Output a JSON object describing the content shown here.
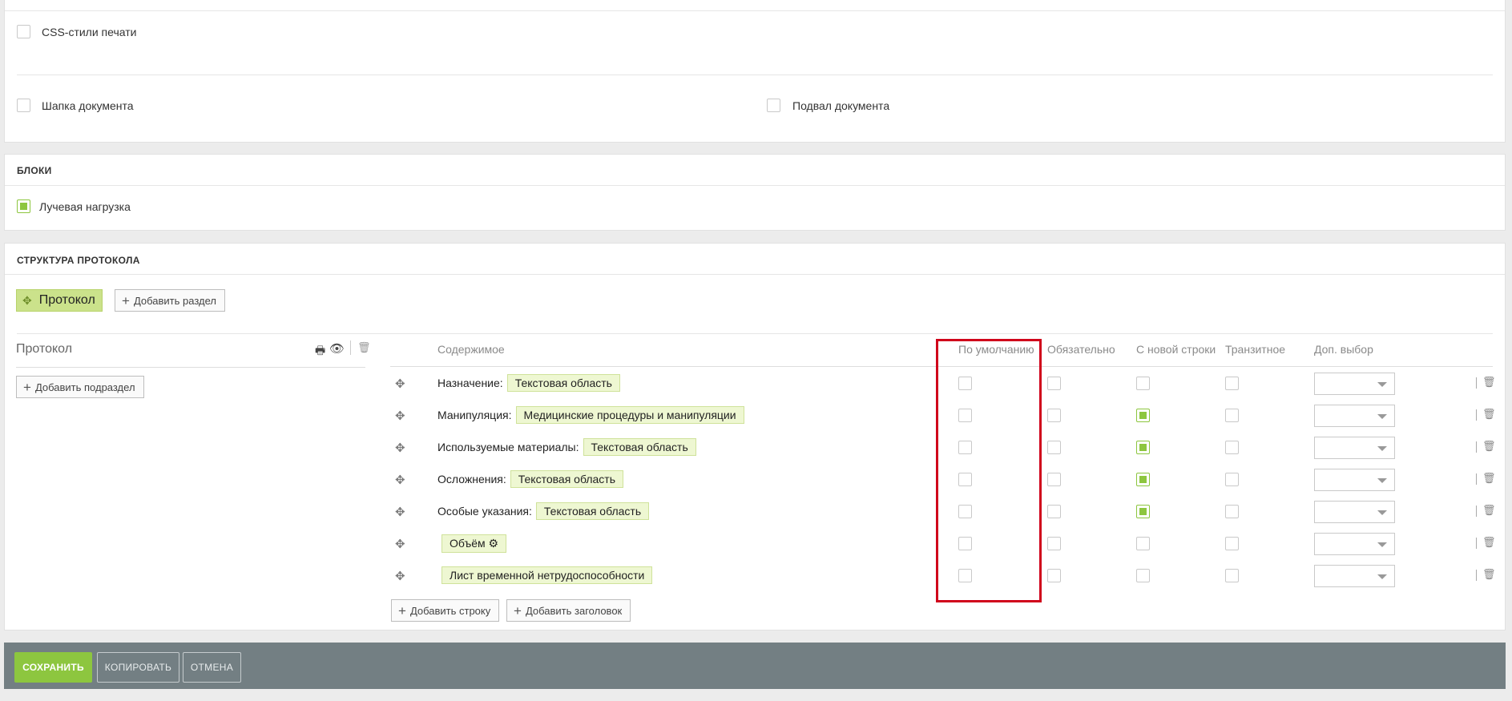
{
  "print_settings": {
    "css_print_label": "CSS-стили печати",
    "header_label": "Шапка документа",
    "footer_label": "Подвал документа"
  },
  "blocks": {
    "title": "БЛОКИ",
    "item_label": "Лучевая нагрузка"
  },
  "structure": {
    "title": "СТРУКТУРА ПРОТОКОЛА",
    "protocol_tab": "Протокол",
    "add_section": "Добавить раздел",
    "section_name": "Протокол",
    "add_subsection": "Добавить подраздел",
    "columns": {
      "content": "Содержимое",
      "default": "По умолчанию",
      "required": "Обязательно",
      "new_line": "С новой строки",
      "transit": "Транзитное",
      "extra_choice": "Доп. выбор"
    },
    "rows": [
      {
        "label": "Назначение:",
        "tag": "Текстовая область",
        "default": false,
        "required": false,
        "new_line": false,
        "transit": false
      },
      {
        "label": "Манипуляция:",
        "tag": "Медицинские процедуры и манипуляции",
        "default": false,
        "required": false,
        "new_line": true,
        "transit": false
      },
      {
        "label": "Используемые материалы:",
        "tag": "Текстовая область",
        "default": false,
        "required": false,
        "new_line": true,
        "transit": false
      },
      {
        "label": "Осложнения:",
        "tag": "Текстовая область",
        "default": false,
        "required": false,
        "new_line": true,
        "transit": false
      },
      {
        "label": "Особые указания:",
        "tag": "Текстовая область",
        "default": false,
        "required": false,
        "new_line": true,
        "transit": false
      },
      {
        "label": "",
        "tag": "Объём ⚙",
        "default": false,
        "required": false,
        "new_line": false,
        "transit": false
      },
      {
        "label": "",
        "tag": "Лист временной нетрудоспособности",
        "default": false,
        "required": false,
        "new_line": false,
        "transit": false
      }
    ],
    "add_row": "Добавить строку",
    "add_header": "Добавить заголовок"
  },
  "footer": {
    "save": "СОХРАНИТЬ",
    "copy": "КОПИРОВАТЬ",
    "cancel": "ОТМЕНА"
  },
  "colors": {
    "accent_green": "#8dc63f",
    "highlight_red": "#d0021b",
    "footer_bg": "#737f83"
  }
}
